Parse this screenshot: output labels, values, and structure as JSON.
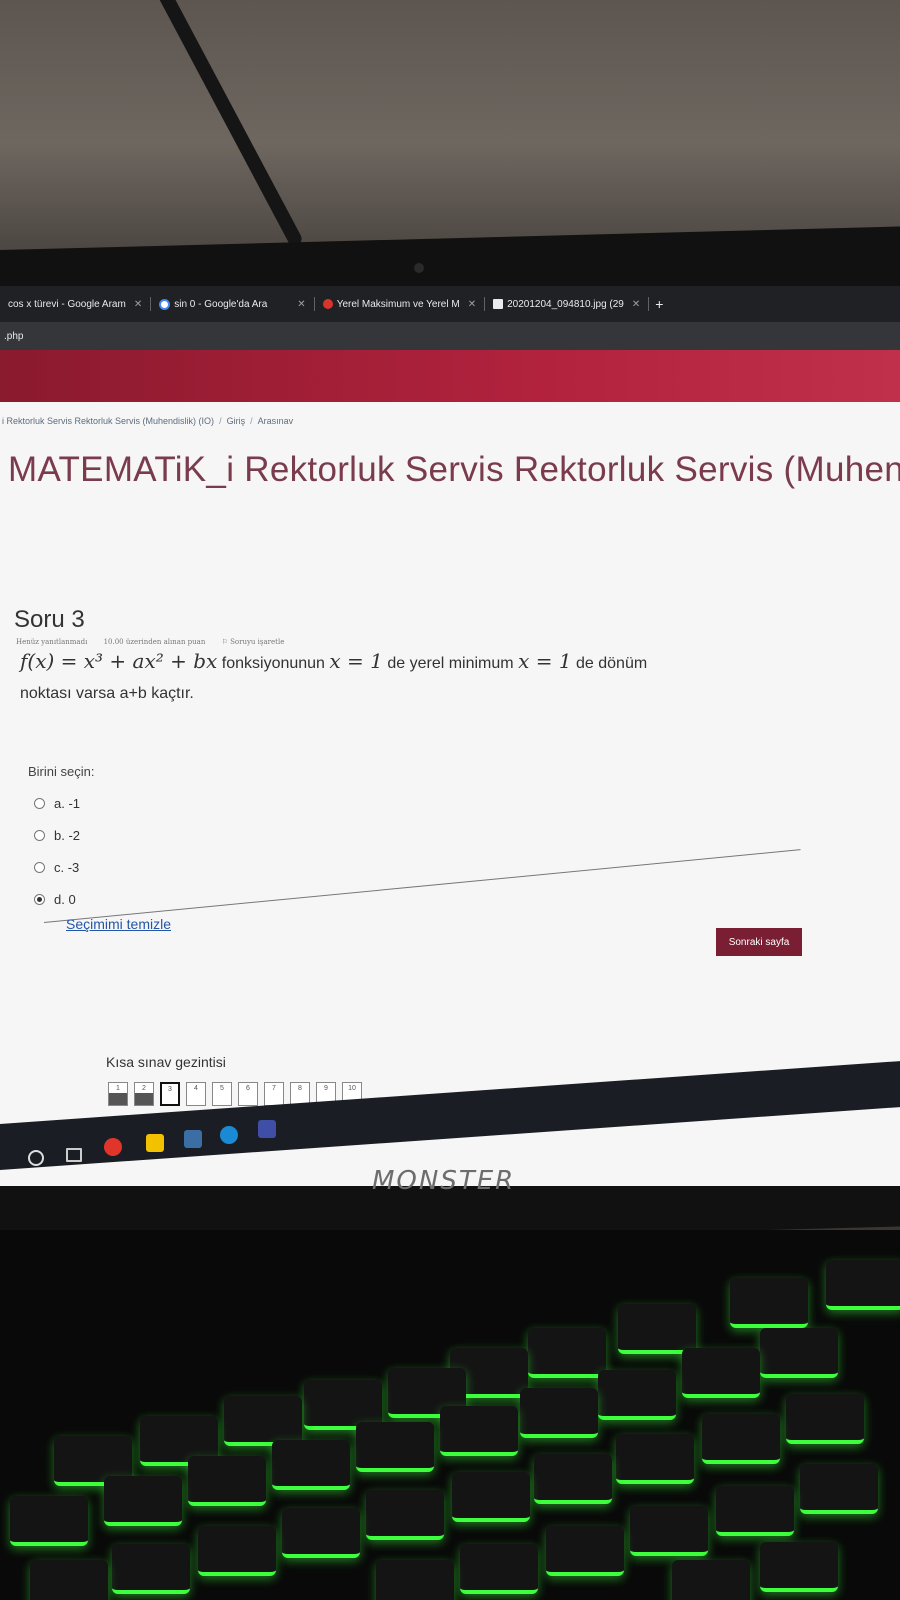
{
  "browser": {
    "tabs": [
      {
        "label": "cos x türevi - Google Aram",
        "icon": "google-icon"
      },
      {
        "label": "sin 0 - Google'da Ara",
        "icon": "google-icon"
      },
      {
        "label": "Yerel Maksimum ve Yerel M",
        "icon": "site-icon"
      },
      {
        "label": "20201204_094810.jpg (29",
        "icon": "image-file-icon"
      }
    ],
    "new_tab": "+",
    "close_glyph": "✕",
    "address": ".php"
  },
  "breadcrumb": {
    "items": [
      "i Rektorluk Servis Rektorluk Servis (Muhendislik) (IO)",
      "Giriş",
      "Arasınav"
    ]
  },
  "page_title": "MATEMATiK_i Rektorluk Servis Rektorluk Servis (Muhendis",
  "question": {
    "title": "Soru 3",
    "status": "Henüz yanıtlanmadı",
    "points": "10.00 üzerinden alınan puan",
    "flag": "Soruyu işaretle",
    "formula": "f(x) = x³ + ax² + bx",
    "text_1": "fonksiyonunun",
    "cond_1": "x = 1",
    "text_2": "de yerel minimum",
    "cond_2": "x = 1",
    "text_3": "de dönüm",
    "text_4": "noktası varsa a+b kaçtır.",
    "prompt": "Birini seçin:",
    "options": [
      {
        "label": "a. -1",
        "selected": false
      },
      {
        "label": "b. -2",
        "selected": false
      },
      {
        "label": "c. -3",
        "selected": false
      },
      {
        "label": "d. 0",
        "selected": true
      }
    ],
    "clear_choice": "Seçimimi temizle"
  },
  "next_button": "Sonraki sayfa",
  "quiz_nav": {
    "title": "Kısa sınav gezintisi",
    "items": [
      "1",
      "2",
      "3",
      "4",
      "5",
      "6",
      "7",
      "8",
      "9",
      "10"
    ],
    "answered": [
      "1",
      "2"
    ],
    "current": "3"
  },
  "brand": "MONSTER",
  "colors": {
    "accent": "#b2223d",
    "button": "#7a1f33",
    "title": "#7a3b4d",
    "key_glow": "#3dff3d"
  }
}
